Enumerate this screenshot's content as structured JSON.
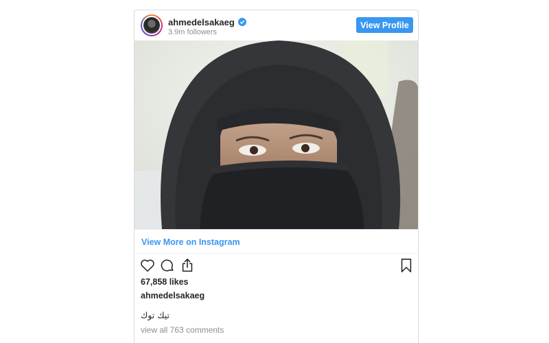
{
  "post": {
    "username": "ahmedelsakaeg",
    "followers": "3.9m followers",
    "view_profile_label": "View Profile",
    "view_more_label": "View More on Instagram",
    "likes": "67,858 likes",
    "caption_username": "ahmedelsakaeg",
    "caption_text": "تيك توك",
    "comments_link": "view all 763 comments"
  },
  "colors": {
    "accent": "#3897f0",
    "muted": "#8e8e8e",
    "text": "#262626"
  },
  "icons": [
    "verified-badge-icon",
    "heart-icon",
    "comment-icon",
    "share-icon",
    "bookmark-icon"
  ]
}
